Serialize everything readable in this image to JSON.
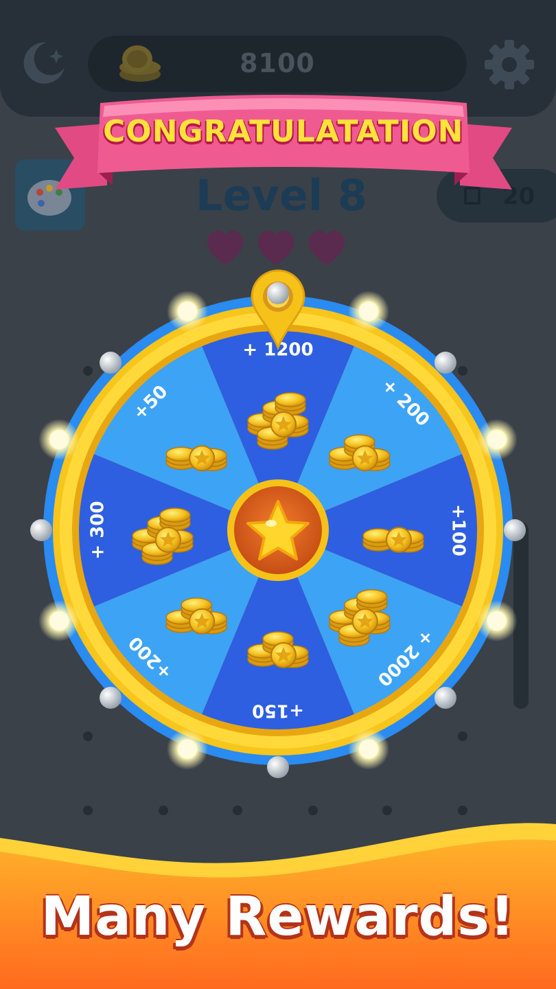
{
  "header": {
    "coins": "8100",
    "moon_icon": "moon-star-icon",
    "coin_icon": "coin-stack-icon",
    "settings_icon": "gear-icon"
  },
  "level": {
    "title": "Level 8",
    "moves": "20",
    "hearts": 3,
    "palette_icon": "palette-icon"
  },
  "banner": {
    "text": "CONGRATULATATION"
  },
  "wheel": {
    "pointer_icon": "pin-pointer-icon",
    "center_icon": "star-icon",
    "segments": [
      {
        "label": "+ 1200",
        "coins": "big-stack"
      },
      {
        "label": "+ 200",
        "coins": "medium-stack"
      },
      {
        "label": "+100",
        "coins": "small-stack"
      },
      {
        "label": "+ 2000",
        "coins": "big-stack"
      },
      {
        "label": "+150",
        "coins": "medium-stack"
      },
      {
        "label": "+200",
        "coins": "medium-stack"
      },
      {
        "label": "+ 300",
        "coins": "big-stack"
      },
      {
        "label": "+50",
        "coins": "small-stack"
      }
    ],
    "colors": {
      "light": "#3da3f5",
      "dark": "#2d5fe0",
      "rim": "#f7c51c",
      "outer": "#2a8bf0"
    }
  },
  "footer": {
    "headline": "Many Rewards!"
  }
}
